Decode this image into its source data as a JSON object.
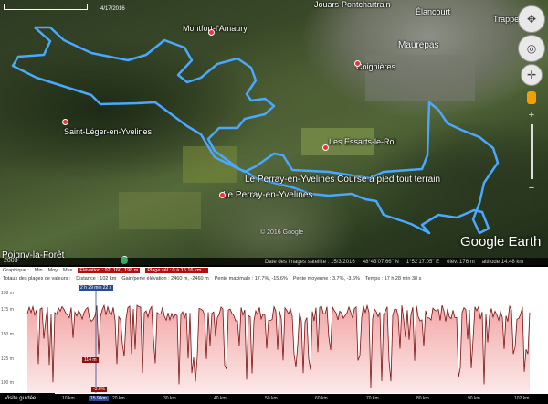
{
  "map": {
    "places": [
      {
        "name": "Jouars-Pontchartrain",
        "id": "place-jouars"
      },
      {
        "name": "Élancourt",
        "id": "place-elancourt"
      },
      {
        "name": "Trappes",
        "id": "place-trappes"
      },
      {
        "name": "Montfort-l'Amaury",
        "id": "place-montfort"
      },
      {
        "name": "Maurepas",
        "id": "place-maurepas"
      },
      {
        "name": "Coignières",
        "id": "place-coignieres"
      },
      {
        "name": "Saint-Léger-en-Yvelines",
        "id": "place-saint-leger"
      },
      {
        "name": "Les Essarts-le-Roi",
        "id": "place-essarts"
      },
      {
        "name": "Le Perray-en-Yvelines Course à pied tout terrain",
        "id": "place-route-name"
      },
      {
        "name": "Le Perray-en-Yvelines",
        "id": "place-perray"
      },
      {
        "name": "Poigny-la-Forêt",
        "id": "place-poigny"
      }
    ],
    "copyright": "© 2016 Google",
    "logo": "Google Earth",
    "scale_label": "4/17/2016"
  },
  "status_bar": {
    "left": "2003",
    "date": "Date des images satellite : 15/3/2016",
    "lat": "48°43'07.66\" N",
    "lon": "1°52'17.05\" E",
    "elev": "élév. 176 m",
    "alt": "altitude 14.48 km"
  },
  "profile": {
    "toolbar1": {
      "graph_label": "Graphique :",
      "min": "Min",
      "moy": "Moy",
      "max": "Max",
      "elevation_tag": "Élévation : 92, 160, 198 m",
      "range_tag": "Plage sél : 0 à 15.16 km ..."
    },
    "toolbar2": {
      "totaux": "Totaux des plages de valeurs :",
      "distance": "Distance : 102 km",
      "gain": "Gain/perte élévation : 2460 m, -2460 m",
      "pente_max": "Pente maximale : 17.7%, -15.6%",
      "pente_moy": "Pente moyenne : 3.7%, -3.6%",
      "temps": "Temps : 17 h 28 min 38 s"
    },
    "y_labels": [
      "198 m",
      "175 m",
      "150 m",
      "125 m",
      "100 m"
    ],
    "x_labels": [
      "10 km",
      "20 km",
      "30 km",
      "40 km",
      "50 km",
      "60 km",
      "70 km",
      "80 km",
      "90 km",
      "102 km"
    ],
    "cursor_top": "2 h 29 min 22 s",
    "cursor_value": "114 m",
    "cursor_slope": "-3.6%",
    "cursor_km": "15.9 km",
    "guided_tour": "Visite guidée"
  }
}
